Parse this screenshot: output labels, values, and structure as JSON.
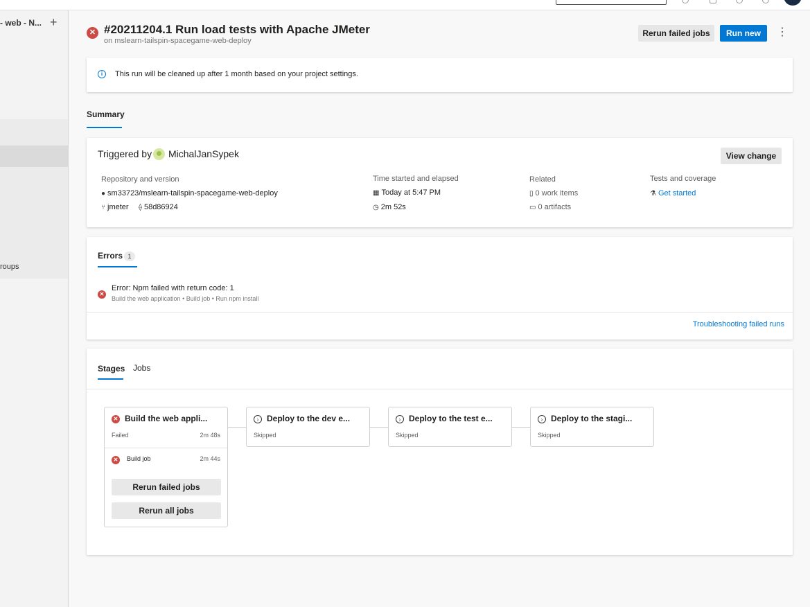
{
  "sidebar": {
    "title": "- web - N...",
    "add_label": "+",
    "groups_label": "roups"
  },
  "header": {
    "status_icon": "error-icon",
    "title": "#20211204.1 Run load tests with Apache JMeter",
    "subtitle": "on mslearn-tailspin-spacegame-web-deploy",
    "rerun_failed_label": "Rerun failed jobs",
    "run_new_label": "Run new",
    "more_label": "⋮"
  },
  "info_banner": {
    "text": "This run will be cleaned up after 1 month based on your project settings."
  },
  "tabs": {
    "summary_label": "Summary"
  },
  "summary": {
    "triggered_by_label": "Triggered by",
    "user": "MichalJanSypek",
    "view_change_label": "View change",
    "repo_label": "Repository and version",
    "repo_name": "sm33723/mslearn-tailspin-spacegame-web-deploy",
    "branch": "jmeter",
    "commit": "58d86924",
    "time_label": "Time started and elapsed",
    "started": "Today at 5:47 PM",
    "elapsed": "2m 52s",
    "related_label": "Related",
    "work_items": "0 work items",
    "artifacts": "0 artifacts",
    "tests_label": "Tests and coverage",
    "get_started": "Get started"
  },
  "errors": {
    "tab_label": "Errors",
    "count": "1",
    "message": "Error: Npm failed with return code: 1",
    "path": "Build the web application • Build job • Run npm install",
    "troubleshoot_link": "Troubleshooting failed runs"
  },
  "stages": {
    "stages_tab": "Stages",
    "jobs_tab": "Jobs",
    "items": [
      {
        "name": "Build the web appli...",
        "status": "Failed",
        "duration": "2m 48s"
      },
      {
        "name": "Deploy to the dev e...",
        "status": "Skipped"
      },
      {
        "name": "Deploy to the test e...",
        "status": "Skipped"
      },
      {
        "name": "Deploy to the stagi...",
        "status": "Skipped"
      }
    ],
    "job": {
      "name": "Build job",
      "duration": "2m 44s"
    },
    "rerun_failed_label": "Rerun failed jobs",
    "rerun_all_label": "Rerun all jobs"
  },
  "colors": {
    "accent": "#0078d4",
    "error": "#cd4a45"
  }
}
